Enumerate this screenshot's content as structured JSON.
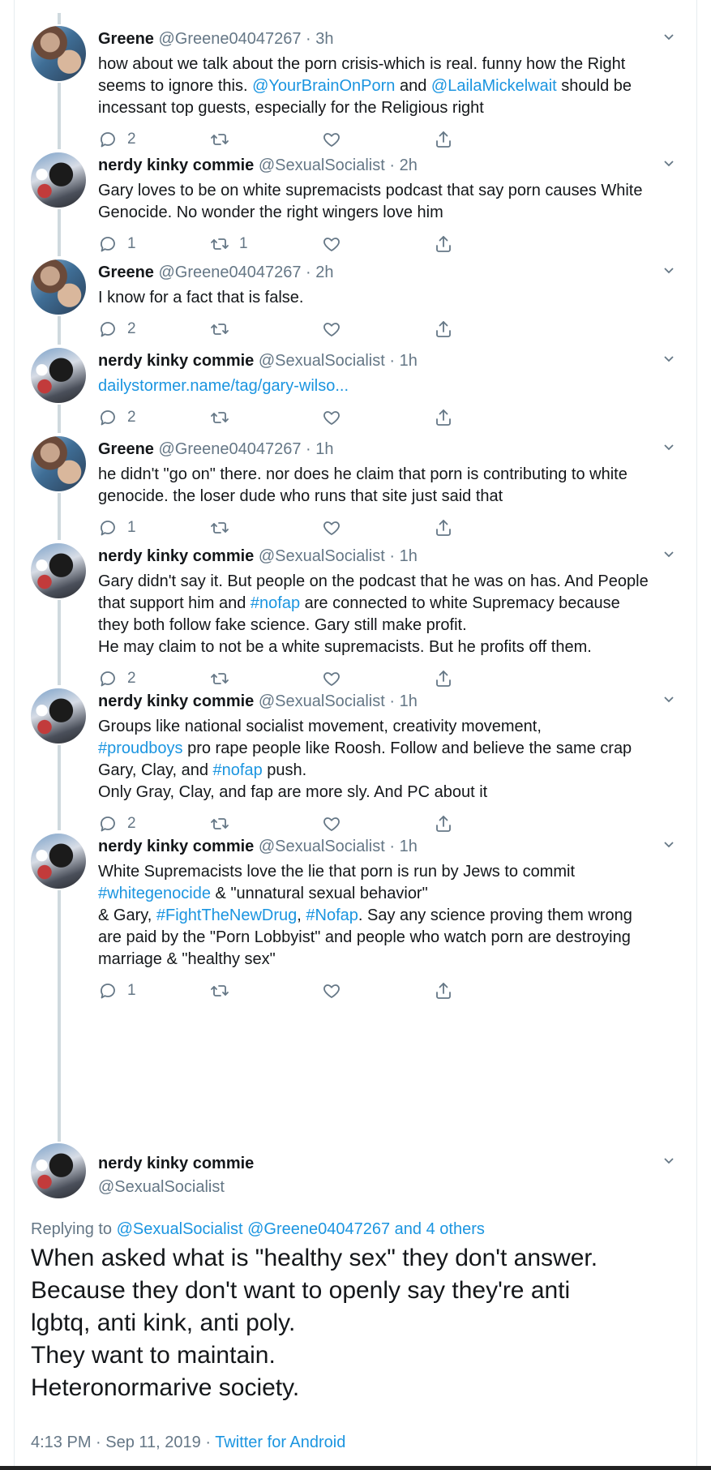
{
  "tweets": [
    {
      "name": "Greene",
      "handle": "@Greene04047267",
      "time": "3h",
      "lines": [
        [
          {
            "t": "how about we talk about the porn crisis-which is real. funny how the Right"
          }
        ],
        [
          {
            "t": "seems to ignore this. "
          },
          {
            "t": "@YourBrainOnPorn",
            "link": true
          },
          {
            "t": " and "
          },
          {
            "t": "@LailaMickelwait",
            "link": true
          },
          {
            "t": " should be"
          }
        ],
        [
          {
            "t": "incessant top guests, especially for the Religious right"
          }
        ]
      ],
      "replies": "2",
      "retweets": "",
      "likes": ""
    },
    {
      "name": "nerdy kinky commie",
      "handle": "@SexualSocialist",
      "time": "2h",
      "lines": [
        [
          {
            "t": "Gary loves to be on white supremacists podcast that say porn causes White"
          }
        ],
        [
          {
            "t": "Genocide. No wonder the right wingers love him"
          }
        ]
      ],
      "replies": "1",
      "retweets": "1",
      "likes": ""
    },
    {
      "name": "Greene",
      "handle": "@Greene04047267",
      "time": "2h",
      "lines": [
        [
          {
            "t": "I know for a fact that is false."
          }
        ]
      ],
      "replies": "2",
      "retweets": "",
      "likes": ""
    },
    {
      "name": "nerdy kinky commie",
      "handle": "@SexualSocialist",
      "time": "1h",
      "lines": [
        [
          {
            "t": "dailystormer.name/tag/gary-wilso...",
            "link": true
          }
        ]
      ],
      "replies": "2",
      "retweets": "",
      "likes": ""
    },
    {
      "name": "Greene",
      "handle": "@Greene04047267",
      "time": "1h",
      "lines": [
        [
          {
            "t": "he didn't \"go on\" there. nor does he claim that porn is contributing to white"
          }
        ],
        [
          {
            "t": "genocide. the loser dude who runs that site just said that"
          }
        ]
      ],
      "replies": "1",
      "retweets": "",
      "likes": ""
    },
    {
      "name": "nerdy kinky commie",
      "handle": "@SexualSocialist",
      "time": "1h",
      "lines": [
        [
          {
            "t": "Gary didn't say it. But people on the podcast that he was on has. And People"
          }
        ],
        [
          {
            "t": "that support him and "
          },
          {
            "t": "#nofap",
            "link": true
          },
          {
            "t": " are connected to white Supremacy because"
          }
        ],
        [
          {
            "t": "they both follow fake science. Gary still make profit."
          }
        ],
        [
          {
            "t": "He may claim to not be a white supremacists. But he profits off them."
          }
        ]
      ],
      "replies": "2",
      "retweets": "",
      "likes": ""
    },
    {
      "name": "nerdy kinky commie",
      "handle": "@SexualSocialist",
      "time": "1h",
      "lines": [
        [
          {
            "t": "Groups like national socialist movement, creativity movement,"
          }
        ],
        [
          {
            "t": "#proudboys",
            "link": true
          },
          {
            "t": " pro rape people like Roosh. Follow and believe the same crap"
          }
        ],
        [
          {
            "t": "Gary, Clay, and "
          },
          {
            "t": "#nofap",
            "link": true
          },
          {
            "t": " push."
          }
        ],
        [
          {
            "t": "Only Gray, Clay, and fap are more sly. And PC about it"
          }
        ]
      ],
      "replies": "2",
      "retweets": "",
      "likes": ""
    },
    {
      "name": "nerdy kinky commie",
      "handle": "@SexualSocialist",
      "time": "1h",
      "lines": [
        [
          {
            "t": "White Supremacists love the lie that porn is run by Jews to commit"
          }
        ],
        [
          {
            "t": "#whitegenocide",
            "link": true
          },
          {
            "t": " & \"unnatural sexual behavior\""
          }
        ],
        [
          {
            "t": "& Gary, "
          },
          {
            "t": "#FightTheNewDrug",
            "link": true
          },
          {
            "t": ", "
          },
          {
            "t": "#Nofap",
            "link": true
          },
          {
            "t": ". Say any science proving them wrong"
          }
        ],
        [
          {
            "t": "are paid by the \"Porn Lobbyist\" and people who watch porn are destroying"
          }
        ],
        [
          {
            "t": "marriage & \"healthy sex\""
          }
        ]
      ],
      "replies": "1",
      "retweets": "",
      "likes": ""
    }
  ],
  "main_tweet": {
    "name": "nerdy kinky commie",
    "handle": "@SexualSocialist",
    "replying_prefix": "Replying to ",
    "replying_to": "@SexualSocialist @Greene04047267 and 4 others",
    "lines": [
      "When asked what is \"healthy sex\" they don't answer.",
      "Because they don't want to openly say they're anti",
      "lgbtq, anti kink, anti poly.",
      "They want to maintain.",
      "Heteronormarive society."
    ],
    "timestamp": "4:13 PM · Sep 11, 2019 · ",
    "source": "Twitter for Android"
  },
  "icons": {
    "reply": "reply-icon",
    "retweet": "retweet-icon",
    "like": "heart-icon",
    "share": "share-icon",
    "menu": "chevron-down-icon"
  },
  "colors": {
    "link": "#1b95e0",
    "secondary": "#657786",
    "text": "#14171a",
    "thread_line": "#cfd9de"
  }
}
